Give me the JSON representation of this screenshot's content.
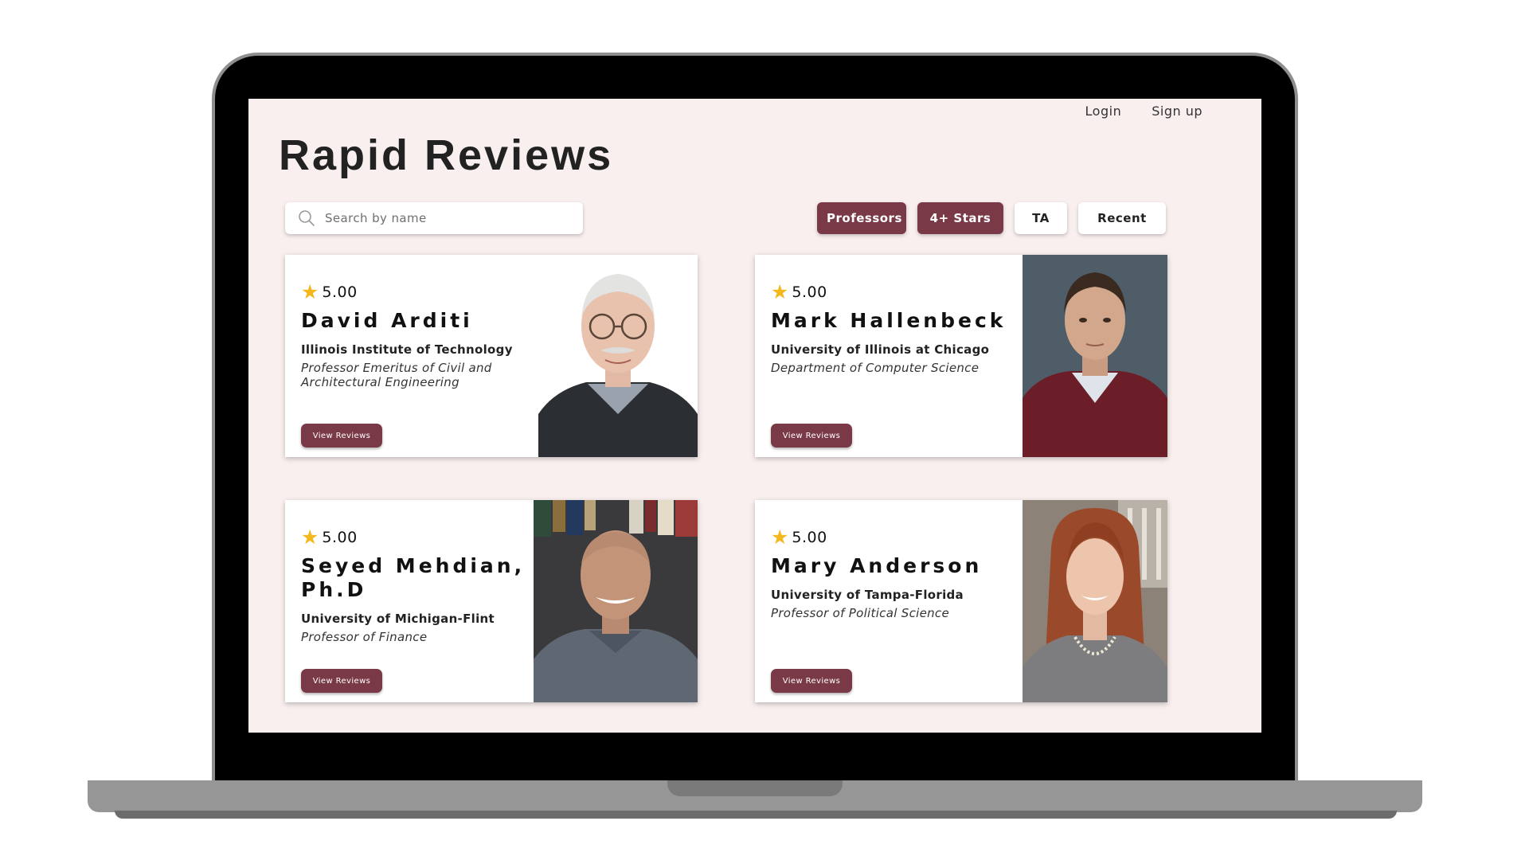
{
  "nav": {
    "login": "Login",
    "signup": "Sign up"
  },
  "site_title": "Rapid Reviews",
  "search": {
    "placeholder": "Search by name",
    "value": ""
  },
  "filters": [
    {
      "label": "Professors",
      "active": true
    },
    {
      "label": "4+ Stars",
      "active": true
    },
    {
      "label": "TA",
      "active": false
    },
    {
      "label": "Recent",
      "active": false
    }
  ],
  "colors": {
    "accent": "#7a3947",
    "background": "#f9efef",
    "star": "#f4b81c"
  },
  "icons": {
    "search": "search-icon",
    "star": "star-icon"
  },
  "professors": [
    {
      "rating": "5.00",
      "name": "David Arditi",
      "institution": "Illinois Institute of Technology",
      "department": "Professor Emeritus of Civil and Architectural Engineering",
      "button": "View Reviews"
    },
    {
      "rating": "5.00",
      "name": "Mark Hallenbeck",
      "institution": "University of Illinois at Chicago",
      "department": "Department of Computer Science",
      "button": "View Reviews"
    },
    {
      "rating": "5.00",
      "name": "Seyed Mehdian, Ph.D",
      "institution": "University of Michigan-Flint",
      "department": "Professor of Finance",
      "button": "View Reviews"
    },
    {
      "rating": "5.00",
      "name": "Mary Anderson",
      "institution": "University of Tampa-Florida",
      "department": "Professor of Political Science",
      "button": "View Reviews"
    }
  ]
}
